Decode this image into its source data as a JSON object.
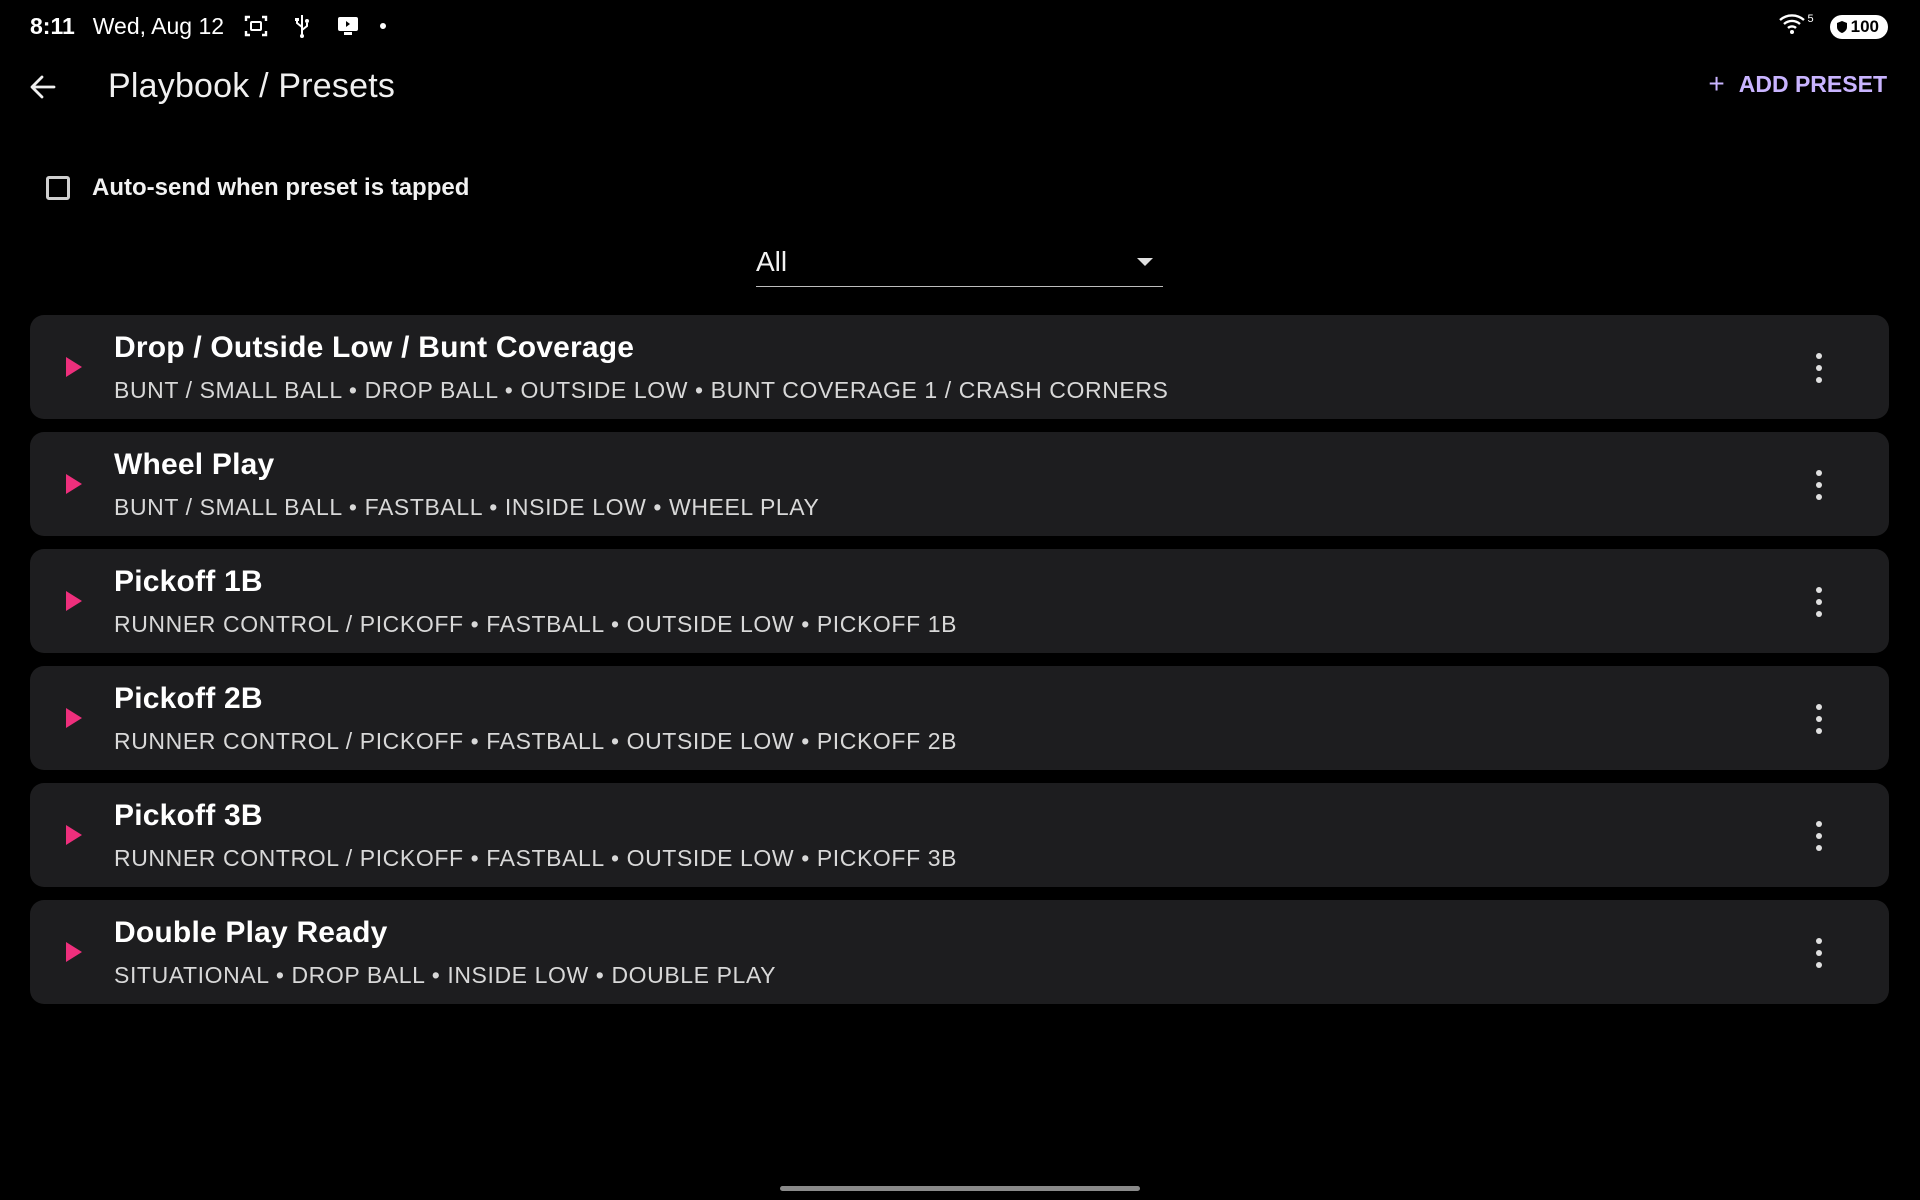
{
  "status_bar": {
    "time": "8:11",
    "date": "Wed, Aug 12",
    "wifi_label": "5",
    "battery": "100"
  },
  "app_bar": {
    "title": "Playbook / Presets",
    "add_label": "ADD PRESET",
    "add_icon": "+"
  },
  "autosend": {
    "label": "Auto-send when preset is tapped",
    "checked": false
  },
  "filter": {
    "selected": "All"
  },
  "presets": [
    {
      "title": "Drop / Outside Low / Bunt Coverage",
      "subtitle": "BUNT / SMALL BALL • DROP BALL • OUTSIDE LOW • BUNT COVERAGE 1 / CRASH CORNERS"
    },
    {
      "title": "Wheel Play",
      "subtitle": "BUNT / SMALL BALL • FASTBALL • INSIDE LOW • WHEEL PLAY"
    },
    {
      "title": "Pickoff 1B",
      "subtitle": "RUNNER CONTROL / PICKOFF • FASTBALL • OUTSIDE LOW • PICKOFF 1B"
    },
    {
      "title": "Pickoff 2B",
      "subtitle": "RUNNER CONTROL / PICKOFF • FASTBALL • OUTSIDE LOW • PICKOFF 2B"
    },
    {
      "title": "Pickoff 3B",
      "subtitle": "RUNNER CONTROL / PICKOFF • FASTBALL • OUTSIDE LOW • PICKOFF 3B"
    },
    {
      "title": "Double Play Ready",
      "subtitle": "SITUATIONAL • DROP BALL • INSIDE LOW • DOUBLE PLAY"
    }
  ],
  "colors": {
    "accent": "#c9b4ff",
    "play": "#ee2f7c",
    "card": "#1d1d1f",
    "background": "#000000"
  }
}
